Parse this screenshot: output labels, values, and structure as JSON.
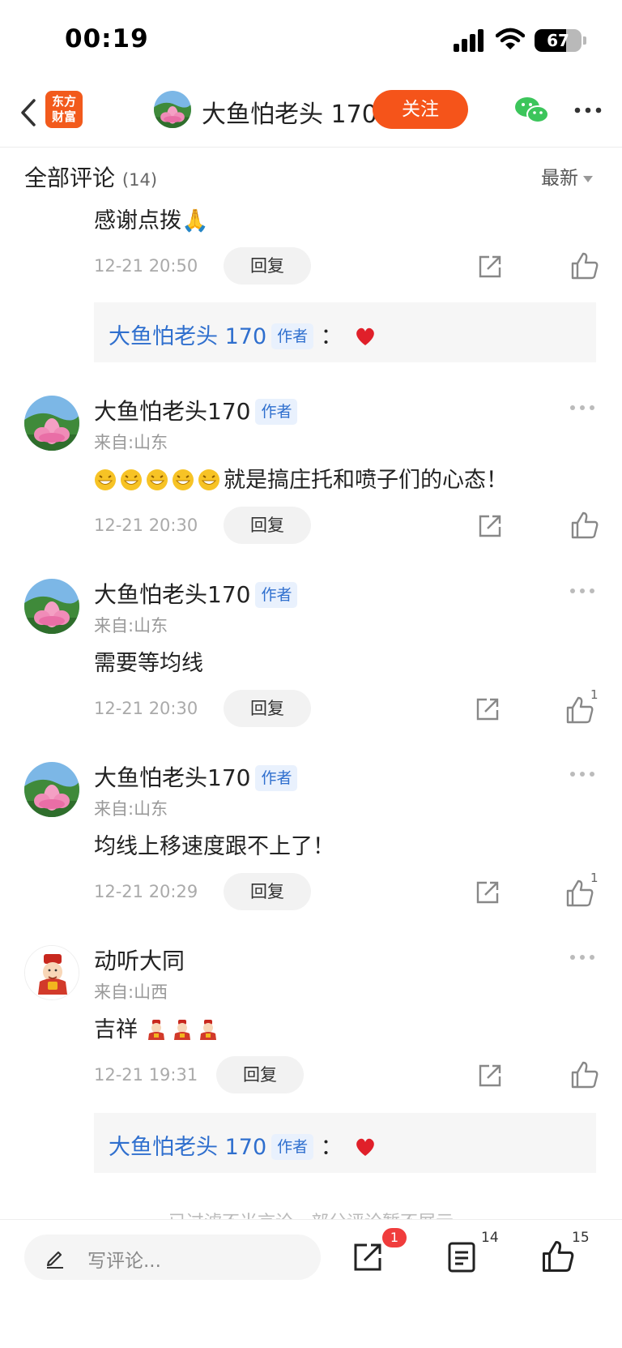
{
  "status_bar": {
    "time": "00:19",
    "battery": "67",
    "battery_level": 0.67
  },
  "nav": {
    "logo_line1": "东方",
    "logo_line2": "财富",
    "title": "大鱼怕老头 170",
    "follow_label": "关注"
  },
  "comments_header": {
    "title": "全部评论",
    "count": "(14)",
    "sort_label": "最新"
  },
  "partial_comment": {
    "text": "感谢点拨🙏",
    "time": "12-21 20:50",
    "reply_label": "回复",
    "sub_reply": {
      "author": "大鱼怕老头 170",
      "tag": "作者",
      "sep": "："
    }
  },
  "comments": [
    {
      "username": "大鱼怕老头170",
      "tag": "作者",
      "location": "来自:山东",
      "text": "就是搞庄托和喷子们的心态！",
      "emoji_count": 5,
      "time": "12-21 20:30",
      "reply_label": "回复",
      "likes": ""
    },
    {
      "username": "大鱼怕老头170",
      "tag": "作者",
      "location": "来自:山东",
      "text": "需要等均线",
      "time": "12-21 20:30",
      "reply_label": "回复",
      "likes": "1"
    },
    {
      "username": "大鱼怕老头170",
      "tag": "作者",
      "location": "来自:山东",
      "text": "均线上移速度跟不上了！",
      "time": "12-21 20:29",
      "reply_label": "回复",
      "likes": "1"
    },
    {
      "username": "动听大同",
      "tag": "",
      "location": "来自:山西",
      "text": "吉祥",
      "emoji_count": 3,
      "time": "12-21 19:31",
      "reply_label": "回复",
      "likes": "",
      "sub_reply": {
        "author": "大鱼怕老头 170",
        "tag": "作者",
        "sep": "："
      }
    }
  ],
  "filter_note": "已过滤不当言论，部分评论暂不展示",
  "bottom_bar": {
    "input_placeholder": "写评论...",
    "share_badge": "1",
    "comment_count": "14",
    "like_count": "15"
  },
  "colors": {
    "accent": "#f5541a",
    "link": "#2f6fce",
    "tag_bg": "#e9f1fd"
  }
}
